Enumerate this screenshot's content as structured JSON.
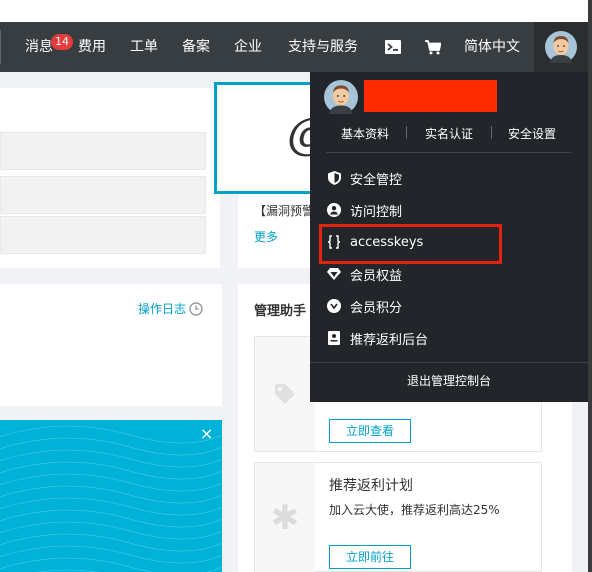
{
  "nav": {
    "messages_label": "消息",
    "messages_badge": "14",
    "billing_label": "费用",
    "tickets_label": "工单",
    "filing_label": "备案",
    "enterprise_label": "企业",
    "support_label": "支持与服务",
    "language_label": "简体中文",
    "icons": [
      "terminal-icon",
      "cart-icon",
      "avatar"
    ]
  },
  "notice": {
    "text": "【漏洞预警",
    "more_label": "更多"
  },
  "activity": {
    "log_label": "操作日志"
  },
  "promo": {
    "close_label": "×"
  },
  "helper": {
    "title": "管理助手",
    "cards": [
      {
        "button_label": "立即查看"
      },
      {
        "title": "推荐返利计划",
        "desc": "加入云大使，推荐返利高达25%",
        "button_label": "立即前往"
      }
    ]
  },
  "account_menu": {
    "links": [
      "基本资料",
      "实名认证",
      "安全设置"
    ],
    "items": [
      {
        "label": "安全管控",
        "icon": "shield-icon"
      },
      {
        "label": "访问控制",
        "icon": "user-circle-icon"
      },
      {
        "label": "accesskeys",
        "icon": "key-bracket-icon",
        "highlighted": true
      },
      {
        "label": "会员权益",
        "icon": "diamond-icon"
      },
      {
        "label": "会员积分",
        "icon": "points-icon"
      },
      {
        "label": "推荐返利后台",
        "icon": "document-icon"
      }
    ],
    "logout_label": "退出管理控制台",
    "username_redacted_color": "#ff2a00",
    "highlight_color": "#e8220f"
  },
  "colors": {
    "navbar": "#373d41",
    "dropdown": "#22262a",
    "accent": "#00a2ca",
    "promo": "#00b2d8"
  }
}
